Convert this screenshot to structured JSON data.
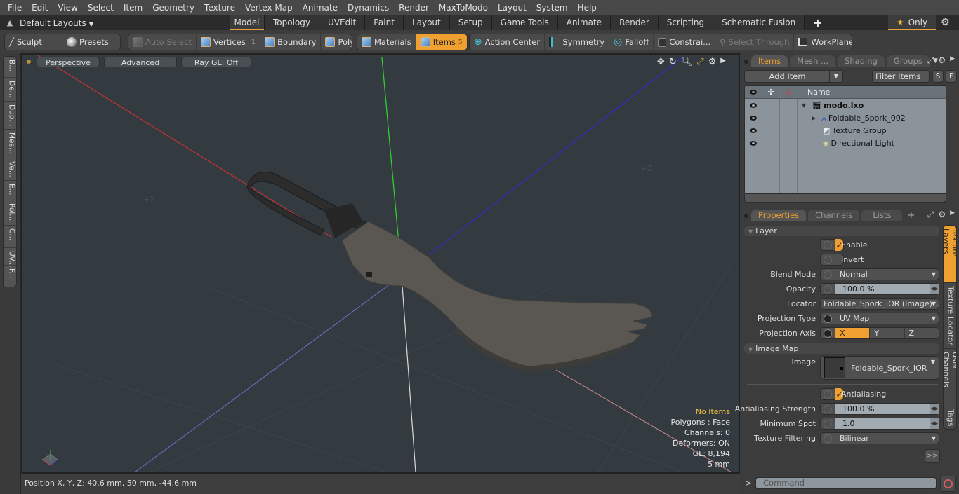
{
  "menu": [
    "File",
    "Edit",
    "View",
    "Select",
    "Item",
    "Geometry",
    "Texture",
    "Vertex Map",
    "Animate",
    "Dynamics",
    "Render",
    "MaxToModo",
    "Layout",
    "System",
    "Help"
  ],
  "layoutbar": {
    "default_layouts": "Default Layouts",
    "tabs": [
      "Model",
      "Topology",
      "UVEdit",
      "Paint",
      "Layout",
      "Setup",
      "Game Tools",
      "Animate",
      "Render",
      "Scripting",
      "Schematic Fusion"
    ],
    "active_tab": "Model",
    "plus": "+",
    "only_label": "Only"
  },
  "toolbar": {
    "sculpt": "Sculpt",
    "presets": "Presets",
    "auto_select": "Auto Select",
    "vertices": "Vertices",
    "vertices_count": "1",
    "boundary": "Boundary",
    "polygons": "Polygons",
    "materials": "Materials",
    "items": "Items",
    "items_count": "5",
    "action_center": "Action Center",
    "symmetry": "Symmetry",
    "falloff": "Falloff",
    "constraints": "Constrai...",
    "select_through": "Select Through",
    "workplane": "WorkPlane"
  },
  "left_tabs": [
    "B...",
    "De...",
    "Dup...",
    "Mes...",
    "Ve...",
    "E...",
    "Pol...",
    "C...",
    "UV...",
    "F..."
  ],
  "viewport": {
    "view": "Perspective",
    "shading": "Advanced",
    "raygl": "Ray GL: Off",
    "info": {
      "selection": "No Items",
      "polygons": "Polygons : Face",
      "channels": "Channels: 0",
      "deformers": "Deformers: ON",
      "gl": "GL: 8,194",
      "grid": "5 mm"
    },
    "axis_labels": {
      "x": "+X",
      "z": "+Z"
    }
  },
  "status": {
    "position": "Position X, Y, Z:   40.6 mm, 50 mm, -44.6 mm"
  },
  "items_panel": {
    "tabs": [
      "Items",
      "Mesh ...",
      "Shading",
      "Groups"
    ],
    "active_tab": "Items",
    "add_item": "Add Item",
    "filter": "Filter Items",
    "s_btn": "S",
    "f_btn": "F",
    "name_header": "Name",
    "tree": [
      {
        "name": "modo.lxo",
        "bold": true
      },
      {
        "name": "Foldable_Spork_002"
      },
      {
        "name": "Texture Group"
      },
      {
        "name": "Directional Light"
      }
    ]
  },
  "properties": {
    "tabs": [
      "Properties",
      "Channels",
      "Lists"
    ],
    "active_tab": "Properties",
    "plus": "+",
    "layer_section": "Layer",
    "enable": "Enable",
    "enable_checked": true,
    "invert": "Invert",
    "invert_checked": false,
    "blend_mode_label": "Blend Mode",
    "blend_mode": "Normal",
    "opacity_label": "Opacity",
    "opacity": "100.0 %",
    "locator_label": "Locator",
    "locator": "Foldable_Spork_IOR (Image) ...",
    "projection_type_label": "Projection Type",
    "projection_type": "UV Map",
    "projection_axis_label": "Projection Axis",
    "projection_axis": [
      "X",
      "Y",
      "Z"
    ],
    "projection_axis_selected": "X",
    "image_map_section": "Image Map",
    "image_label": "Image",
    "image": "Foldable_Spork_IOR",
    "antialiasing": "Antialiasing",
    "antialiasing_checked": true,
    "aa_strength_label": "Antialiasing Strength",
    "aa_strength": "100.0 %",
    "min_spot_label": "Minimum Spot",
    "min_spot": "1.0",
    "tex_filter_label": "Texture Filtering",
    "tex_filter": "Bilinear",
    "more": ">>",
    "side_tabs": [
      "Texture Layers",
      "Texture Locator",
      "User Channels",
      "Tags"
    ],
    "active_side_tab": "Texture Layers"
  },
  "command": {
    "prompt": ">",
    "placeholder": "Command"
  },
  "colors": {
    "accent": "#f0a030",
    "viewport_bg": "#343b40",
    "axis_x": "#c83232",
    "axis_y": "#32c832",
    "axis_z": "#3232c0"
  }
}
